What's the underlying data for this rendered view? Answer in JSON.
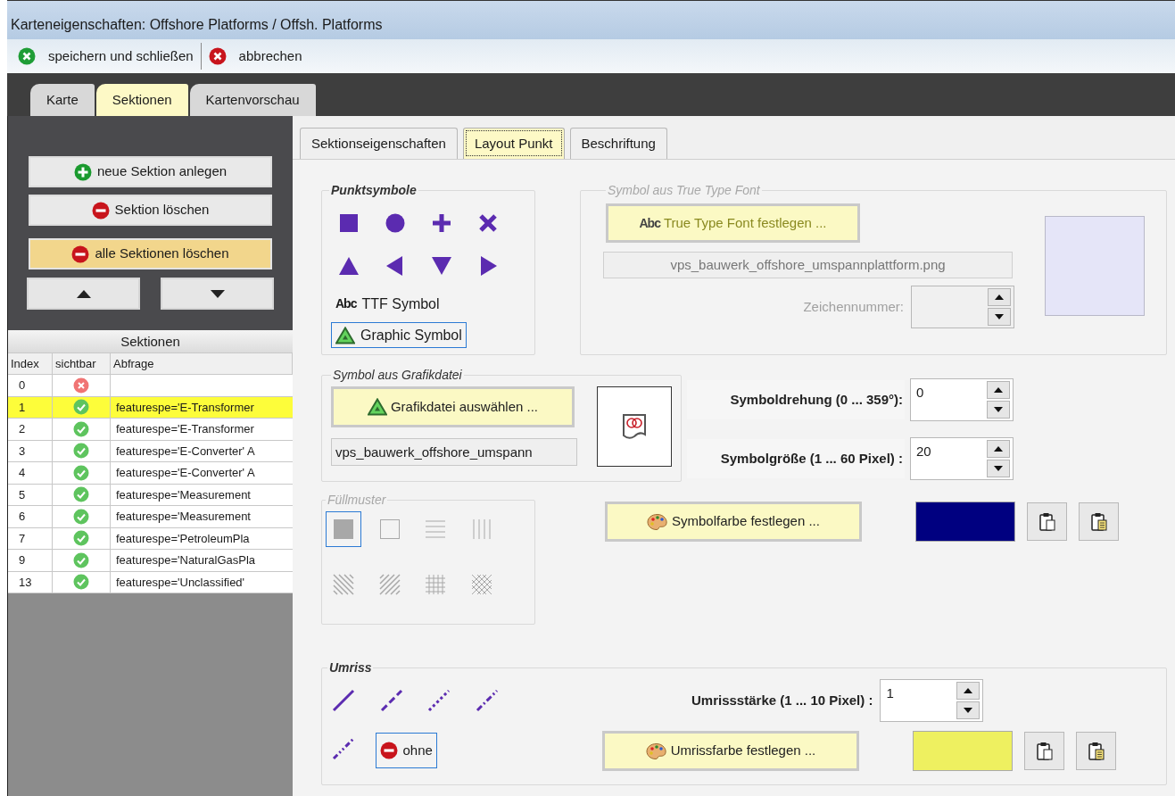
{
  "window": {
    "title": "Karteneigenschaften: Offshore Platforms / Offsh. Platforms"
  },
  "toolbar": [
    {
      "kind": "save",
      "label": "speichern und schließen"
    },
    {
      "kind": "cancel",
      "label": "abbrechen"
    }
  ],
  "tabs": [
    {
      "label": "Karte",
      "selected": false
    },
    {
      "label": "Sektionen",
      "selected": true
    },
    {
      "label": "Kartenvorschau",
      "selected": false
    }
  ],
  "section_buttons": [
    {
      "kind": "add",
      "label": "neue Sektion anlegen",
      "highlighted": false
    },
    {
      "kind": "remove",
      "label": "Sektion löschen",
      "highlighted": false
    },
    {
      "kind": "remove",
      "label": "alle Sektionen löschen",
      "highlighted": true
    }
  ],
  "move_buttons": [
    {
      "kind": "up"
    },
    {
      "kind": "down"
    }
  ],
  "sections_table": {
    "title": "Sektionen",
    "columns": [
      "Index",
      "sichtbar",
      "Abfrage"
    ],
    "rows": [
      {
        "index": "0",
        "visible": false,
        "selected": false
      },
      {
        "index": "1",
        "visible": true,
        "query": "featurespe='E-Transformer",
        "selected": true
      },
      {
        "index": "2",
        "visible": true,
        "query": "featurespe='E-Transformer",
        "selected": false
      },
      {
        "index": "3",
        "visible": true,
        "query": "featurespe='E-Converter' A",
        "selected": false
      },
      {
        "index": "4",
        "visible": true,
        "query": "featurespe='E-Converter' A",
        "selected": false
      },
      {
        "index": "5",
        "visible": true,
        "query": "featurespe='Measurement",
        "selected": false
      },
      {
        "index": "6",
        "visible": true,
        "query": "featurespe='Measurement",
        "selected": false
      },
      {
        "index": "7",
        "visible": true,
        "query": "featurespe='PetroleumPla",
        "selected": false
      },
      {
        "index": "9",
        "visible": true,
        "query": "featurespe='NaturalGasPla",
        "selected": false
      },
      {
        "index": "13",
        "visible": true,
        "query": "featurespe='Unclassified'",
        "selected": false
      }
    ]
  },
  "subtabs": [
    {
      "label": "Sektionseigenschaften",
      "selected": false
    },
    {
      "label": "Layout Punkt",
      "selected": true
    },
    {
      "label": "Beschriftung",
      "selected": false
    }
  ],
  "point_symbols": {
    "title": "Punktsymbole",
    "options": [
      {
        "kind": "square",
        "selected": false
      },
      {
        "kind": "circle",
        "selected": false
      },
      {
        "kind": "plus",
        "selected": false
      },
      {
        "kind": "cross",
        "selected": false
      },
      {
        "kind": "triangle-up",
        "selected": false
      },
      {
        "kind": "triangle-left",
        "selected": false
      },
      {
        "kind": "triangle-down",
        "selected": false
      },
      {
        "kind": "triangle-right",
        "selected": false
      },
      {
        "kind": "ttf",
        "icon_text": "Abc",
        "label": "TTF Symbol",
        "selected": false
      },
      {
        "kind": "graphic",
        "label": "Graphic Symbol",
        "selected": true
      }
    ]
  },
  "ttf_group": {
    "title": "Symbol aus True Type Font",
    "enabled": false,
    "button_icon_text": "Abc",
    "button": "True Type Font festlegen ...",
    "file": "vps_bauwerk_offshore_umspannplattform.png",
    "char_label": "Zeichennummer:"
  },
  "graphic_file": {
    "title": "Symbol aus Grafikdatei",
    "button": "Grafikdatei auswählen ...",
    "file": "vps_bauwerk_offshore_umspann"
  },
  "rotation": {
    "label": "Symboldrehung (0 ... 359°):",
    "value": "0"
  },
  "size": {
    "label": "Symbolgröße (1 ... 60 Pixel) :",
    "value": "20"
  },
  "fill": {
    "title": "Füllmuster",
    "enabled": false,
    "patterns": [
      {
        "kind": "solid",
        "selected": true
      },
      {
        "kind": "empty",
        "selected": false
      },
      {
        "kind": "horizontal",
        "selected": false
      },
      {
        "kind": "vertical",
        "selected": false
      },
      {
        "kind": "diagonal-back",
        "selected": false
      },
      {
        "kind": "diagonal-forward",
        "selected": false
      },
      {
        "kind": "grid",
        "selected": false
      },
      {
        "kind": "crosshatch",
        "selected": false
      }
    ]
  },
  "symbol_color": {
    "button": "Symbolfarbe festlegen ...",
    "color": "#000080"
  },
  "outline": {
    "title": "Umriss",
    "styles": [
      {
        "kind": "solid",
        "selected": false
      },
      {
        "kind": "dash",
        "selected": false
      },
      {
        "kind": "dot",
        "selected": false
      },
      {
        "kind": "dashdot",
        "selected": false
      },
      {
        "kind": "dashdotdot",
        "selected": false
      },
      {
        "kind": "none",
        "label": "ohne",
        "selected": true
      }
    ],
    "width": {
      "label": "Umrissstärke (1 ... 10 Pixel) :",
      "value": "1"
    },
    "color_button": "Umrissfarbe festlegen ...",
    "color": "#eef060"
  }
}
